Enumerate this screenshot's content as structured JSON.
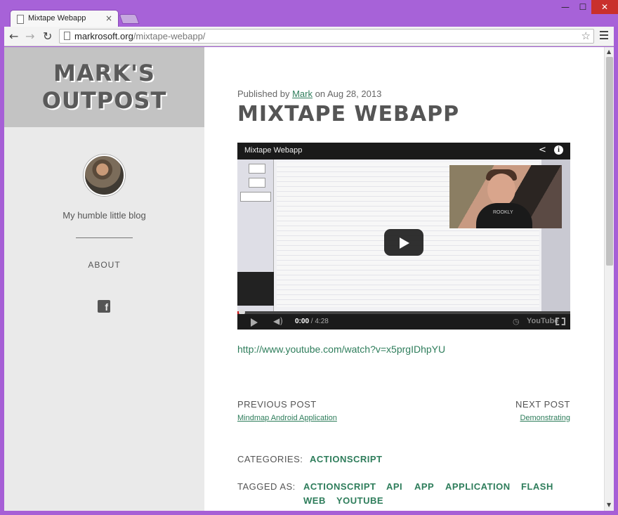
{
  "browser": {
    "tab_title": "Mixtape Webapp",
    "tab_close": "×",
    "window_min": "—",
    "window_max": "☐",
    "window_close": "✕",
    "back": "←",
    "forward": "→",
    "reload": "↻",
    "url_host": "markrosoft.org",
    "url_path": "/mixtape-webapp/",
    "bookmark_star": "☆"
  },
  "sidebar": {
    "site_title_line1": "MARK'S",
    "site_title_line2": "OUTPOST",
    "tagline": "My humble little blog",
    "about": "ABOUT",
    "facebook": "f"
  },
  "post": {
    "published_prefix": "Published by",
    "author": "Mark",
    "published_suffix": "on Aug 28, 2013",
    "title": "MIXTAPE WEBAPP",
    "video": {
      "title": "Mixtape Webapp",
      "webcam_shirt_text": "ROOKLY",
      "time_current": "0:00",
      "time_sep": " / ",
      "time_total": "4:28",
      "youtube_logo": "YouTube",
      "progress": 0.0
    },
    "video_link": "http://www.youtube.com/watch?v=x5prgIDhpYU",
    "previous_label": "PREVIOUS POST",
    "previous_title": "Mindmap Android Application",
    "next_label": "NEXT POST",
    "next_title": "Demonstrating",
    "categories_label": "CATEGORIES:",
    "categories": [
      "ACTIONSCRIPT"
    ],
    "tagged_label": "TAGGED AS:",
    "tags": [
      "ACTIONSCRIPT",
      "API",
      "APP",
      "APPLICATION",
      "FLASH",
      "WEB",
      "YOUTUBE"
    ]
  },
  "colors": {
    "frame": "#a762d8",
    "link": "#2e7d5b",
    "sidebar_bg": "#eaeaea",
    "title_box_bg": "#c3c3c3"
  }
}
